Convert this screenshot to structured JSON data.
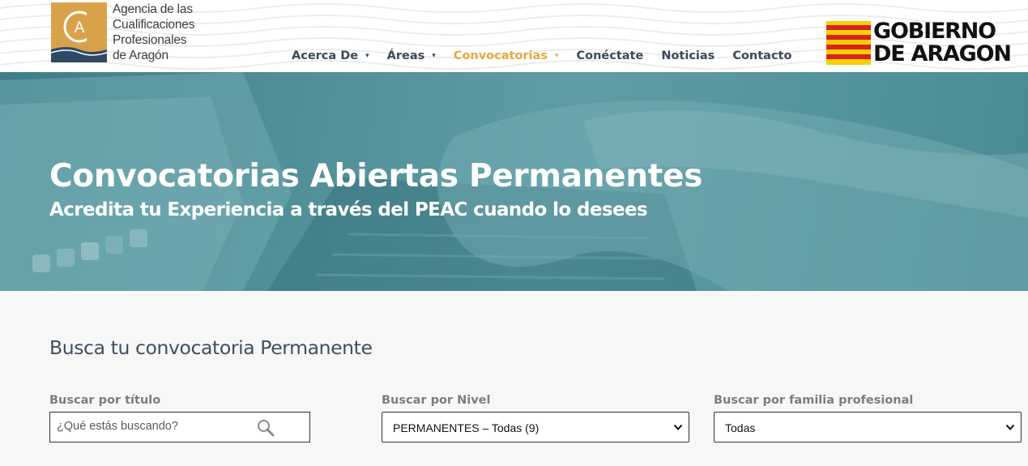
{
  "header": {
    "logo_letter": "A",
    "logo_text": [
      "Agencia de las",
      "Cualificaciones",
      "Profesionales",
      "de Aragón"
    ],
    "nav": [
      {
        "label": "Acerca De",
        "has_caret": true,
        "active": false
      },
      {
        "label": "Áreas",
        "has_caret": true,
        "active": false
      },
      {
        "label": "Convocatorias",
        "has_caret": true,
        "active": true
      },
      {
        "label": "Conéctate",
        "has_caret": false,
        "active": false
      },
      {
        "label": "Noticias",
        "has_caret": false,
        "active": false
      },
      {
        "label": "Contacto",
        "has_caret": false,
        "active": false
      }
    ],
    "caret_glyph": "▾",
    "gobierno_line1": "GOBIERNO",
    "gobierno_line2": "DE ARAGON"
  },
  "hero": {
    "title": "Convocatorias Abiertas Permanentes",
    "subtitle": "Acredita tu Experiencia a través del PEAC cuando lo desees"
  },
  "search": {
    "section_title": "Busca tu convocatoria Permanente",
    "title_label": "Buscar por título",
    "title_placeholder": "¿Qué estás buscando?",
    "level_label": "Buscar por Nivel",
    "level_value": "PERMANENTES – Todas (9)",
    "family_label": "Buscar por familia profesional",
    "family_value": "Todas"
  },
  "colors": {
    "accent": "#e3aa3f",
    "nav_text": "#3a4a5a",
    "hero_bg": "#5a969f",
    "logo_gold": "#d9a24a",
    "logo_navy": "#2e4a66"
  }
}
